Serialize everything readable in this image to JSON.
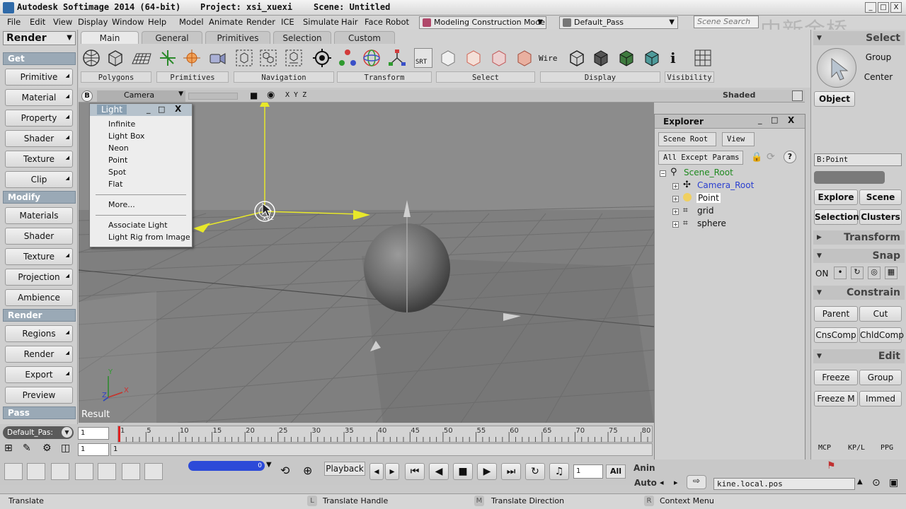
{
  "window": {
    "app_title": "Autodesk Softimage 2014 (64-bit)",
    "project": "Project: xsi_xuexi",
    "scene": "Scene: Untitled",
    "minimize": "_",
    "maximize": "□",
    "close": "X"
  },
  "menubar": {
    "items": [
      "File",
      "Edit",
      "View",
      "Display",
      "Window",
      "Help",
      "Model",
      "Animate",
      "Render",
      "ICE",
      "Simulate",
      "Hair",
      "Face Robot"
    ],
    "mode": "Modeling Construction Mode",
    "pass": "Default_Pass",
    "search_placeholder": "Scene Search",
    "watermark": "中新金桥"
  },
  "left_panel": {
    "module": "Render",
    "sections": [
      {
        "title": "Get",
        "buttons": [
          "Primitive",
          "Material",
          "Property",
          "Shader",
          "Texture",
          "Clip"
        ]
      },
      {
        "title": "Modify",
        "buttons": [
          "Materials",
          "Shader",
          "Texture",
          "Projection",
          "Ambience"
        ]
      },
      {
        "title": "Render",
        "buttons": [
          "Regions",
          "Render",
          "Export",
          "Preview"
        ]
      },
      {
        "title": "Pass",
        "buttons": []
      }
    ],
    "pass_select": "Default_Pas:"
  },
  "toolbar": {
    "tabs": [
      "Main",
      "General",
      "Primitives",
      "Selection",
      "Custom"
    ],
    "groups": [
      "Polygons",
      "Primitives",
      "Navigation",
      "Transform",
      "Select",
      "Display",
      "Visibility"
    ],
    "srt_label": "SRT",
    "wire_label": "Wire",
    "info_label": "i"
  },
  "viewport": {
    "letter": "B",
    "camera": "Camera",
    "axes": "X Y Z",
    "shading": "Shaded",
    "result": "Result",
    "gizmo_label": "xyz"
  },
  "light_popup": {
    "title": "Light",
    "items": [
      "Infinite",
      "Light Box",
      "Neon",
      "Point",
      "Spot",
      "Flat"
    ],
    "more": "More...",
    "extra": [
      "Associate Light",
      "Light Rig from Image"
    ]
  },
  "explorer": {
    "title": "Explorer",
    "scope": "Scene Root",
    "view": "View",
    "filter": "All Except Params",
    "tree": [
      {
        "label": "Scene_Root",
        "color": "#1f8a1f",
        "level": 0
      },
      {
        "label": "Camera_Root",
        "color": "#2a3fcf",
        "level": 1
      },
      {
        "label": "Point",
        "color": "#000000",
        "level": 1
      },
      {
        "label": "grid",
        "color": "#000000",
        "level": 1
      },
      {
        "label": "sphere",
        "color": "#000000",
        "level": 1
      }
    ]
  },
  "right_panel": {
    "select_header": "Select",
    "group": "Group",
    "center": "Center",
    "object": "Object",
    "selection_field": "B:Point",
    "explore": "Explore",
    "scene": "Scene",
    "selection": "Selection",
    "clusters": "Clusters",
    "transform": "Transform",
    "snap": "Snap",
    "on": "ON",
    "constrain": "Constrain",
    "parent": "Parent",
    "cut": "Cut",
    "cnscomp": "CnsComp",
    "chldcomp": "ChldComp",
    "edit": "Edit",
    "freeze": "Freeze",
    "group2": "Group",
    "freeze_m": "Freeze M",
    "immed": "Immed",
    "tabs": [
      "MCP",
      "KP/L",
      "PPG"
    ]
  },
  "timeline": {
    "start": "1",
    "current": "1",
    "end_label": "1",
    "ticks": [
      "1",
      "5",
      "10",
      "15",
      "20",
      "25",
      "30",
      "35",
      "40",
      "45",
      "50",
      "55",
      "60",
      "65",
      "70",
      "75",
      "80"
    ],
    "playback": "Playback",
    "frame_field": "1",
    "all": "All",
    "anim": "Anin",
    "auto": "Auto",
    "slider_value": "0"
  },
  "command_field": "kine.local.pos",
  "statusbar": {
    "left": "Translate",
    "l_key": "L",
    "l_text": "Translate Handle",
    "m_key": "M",
    "m_text": "Translate Direction",
    "r_key": "R",
    "r_text": "Context Menu"
  }
}
